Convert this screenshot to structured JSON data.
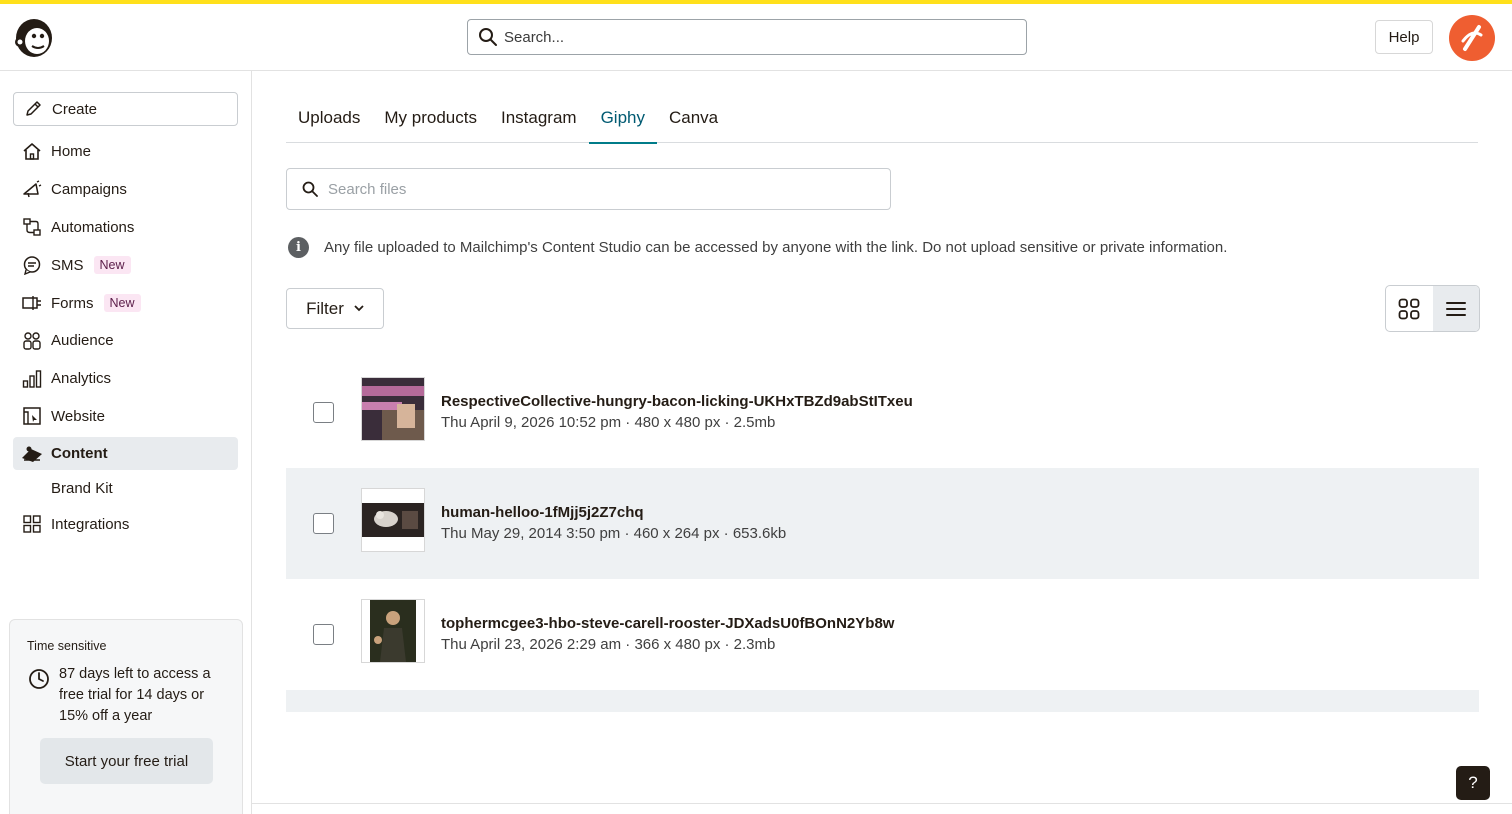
{
  "header": {
    "search_placeholder": "Search...",
    "help_label": "Help"
  },
  "sidebar": {
    "create_label": "Create",
    "items": [
      {
        "label": "Home",
        "icon": "home-icon"
      },
      {
        "label": "Campaigns",
        "icon": "megaphone-icon"
      },
      {
        "label": "Automations",
        "icon": "automation-icon"
      },
      {
        "label": "SMS",
        "icon": "chat-icon",
        "badge": "New"
      },
      {
        "label": "Forms",
        "icon": "form-icon",
        "badge": "New"
      },
      {
        "label": "Audience",
        "icon": "audience-icon"
      },
      {
        "label": "Analytics",
        "icon": "bar-chart-icon"
      },
      {
        "label": "Website",
        "icon": "website-icon"
      },
      {
        "label": "Content",
        "icon": "content-icon",
        "active": true
      },
      {
        "label": "Brand Kit",
        "sub": true
      },
      {
        "label": "Integrations",
        "icon": "grid-icon"
      }
    ],
    "trial": {
      "title": "Time sensitive",
      "message": "87 days left to access a free trial for 14 days or 15% off a year",
      "button_label": "Start your free trial"
    }
  },
  "main": {
    "tabs": [
      {
        "label": "Uploads"
      },
      {
        "label": "My products"
      },
      {
        "label": "Instagram"
      },
      {
        "label": "Giphy",
        "active": true
      },
      {
        "label": "Canva"
      }
    ],
    "file_search_placeholder": "Search files",
    "notice": "Any file uploaded to Mailchimp's Content Studio can be accessed by anyone with the link. Do not upload sensitive or private information.",
    "filter_label": "Filter",
    "view_mode": "list",
    "files": [
      {
        "name": "RespectiveCollective-hungry-bacon-licking-UKHxTBZd9abStITxeu",
        "meta": "Thu April 9, 2026 10:52 pm · 480 x 480 px · 2.5mb"
      },
      {
        "name": "human-helloo-1fMjj5j2Z7chq",
        "meta": "Thu May 29, 2014 3:50 pm · 460 x 264 px · 653.6kb"
      },
      {
        "name": "tophermcgee3-hbo-steve-carell-rooster-JDXadsU0fBOnN2Yb8w",
        "meta": "Thu April 23, 2026 2:29 am · 366 x 480 px · 2.3mb"
      }
    ]
  },
  "help_fab_label": "?",
  "colors": {
    "brand_yellow": "#ffe01b",
    "accent_teal": "#007c89",
    "avatar_orange": "#ef5e31"
  }
}
